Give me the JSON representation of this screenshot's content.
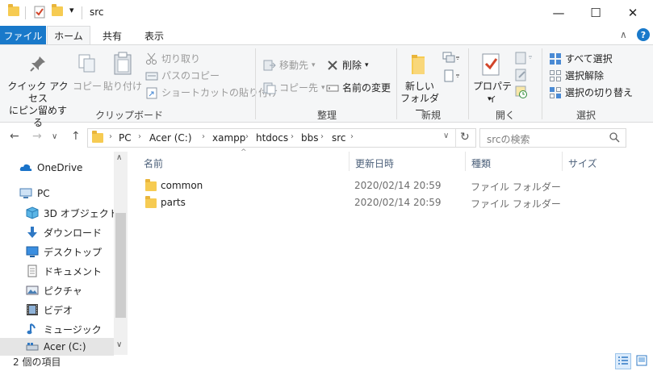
{
  "window": {
    "title": "src",
    "minimize": "—",
    "maximize": "☐",
    "close": "✕"
  },
  "quick_access": {
    "dropdown": "▾"
  },
  "ribbon_tabs": {
    "file": "ファイル",
    "home": "ホーム",
    "share": "共有",
    "view": "表示"
  },
  "ribbon_controls": {
    "collapse": "∧",
    "help": "?"
  },
  "clipboard": {
    "pin_label": "クイック アクセス\nにピン留めする",
    "copy": "コピー",
    "paste": "貼り付け",
    "cut": "切り取り",
    "copy_path": "パスのコピー",
    "paste_shortcut": "ショートカットの貼り付け",
    "group": "クリップボード"
  },
  "organize": {
    "move_to": "移動先",
    "copy_to": "コピー先",
    "delete": "削除",
    "rename": "名前の変更",
    "group": "整理"
  },
  "new": {
    "new_folder": "新しい\nフォルダー",
    "group": "新規"
  },
  "open": {
    "properties": "プロパティ",
    "group": "開く"
  },
  "select": {
    "select_all": "すべて選択",
    "select_none": "選択解除",
    "invert": "選択の切り替え",
    "group": "選択"
  },
  "address": {
    "back": "←",
    "forward": "→",
    "recent": "∨",
    "up": "↑",
    "crumbs": [
      "PC",
      "Acer (C:)",
      "xampp",
      "htdocs",
      "bbs",
      "src"
    ],
    "refresh": "↻",
    "dropdown": "∨"
  },
  "search": {
    "placeholder": "srcの検索"
  },
  "nav_pane": {
    "items": [
      {
        "label": "OneDrive"
      },
      {
        "label": "PC"
      },
      {
        "label": "3D オブジェクト"
      },
      {
        "label": "ダウンロード"
      },
      {
        "label": "デスクトップ"
      },
      {
        "label": "ドキュメント"
      },
      {
        "label": "ピクチャ"
      },
      {
        "label": "ビデオ"
      },
      {
        "label": "ミュージック"
      },
      {
        "label": "Acer (C:)"
      }
    ],
    "scroll_up": "∧",
    "scroll_down": "∨"
  },
  "file_list": {
    "columns": {
      "name": "名前",
      "date": "更新日時",
      "type": "種類",
      "size": "サイズ"
    },
    "sort_arrow": "^",
    "rows": [
      {
        "name": "common",
        "date": "2020/02/14 20:59",
        "type": "ファイル フォルダー",
        "size": ""
      },
      {
        "name": "parts",
        "date": "2020/02/14 20:59",
        "type": "ファイル フォルダー",
        "size": ""
      }
    ]
  },
  "status": {
    "item_count": "2 個の項目"
  },
  "colors": {
    "accent": "#1979ca",
    "folder": "#f6cb52",
    "ribbon_bg": "#f5f6f7"
  }
}
